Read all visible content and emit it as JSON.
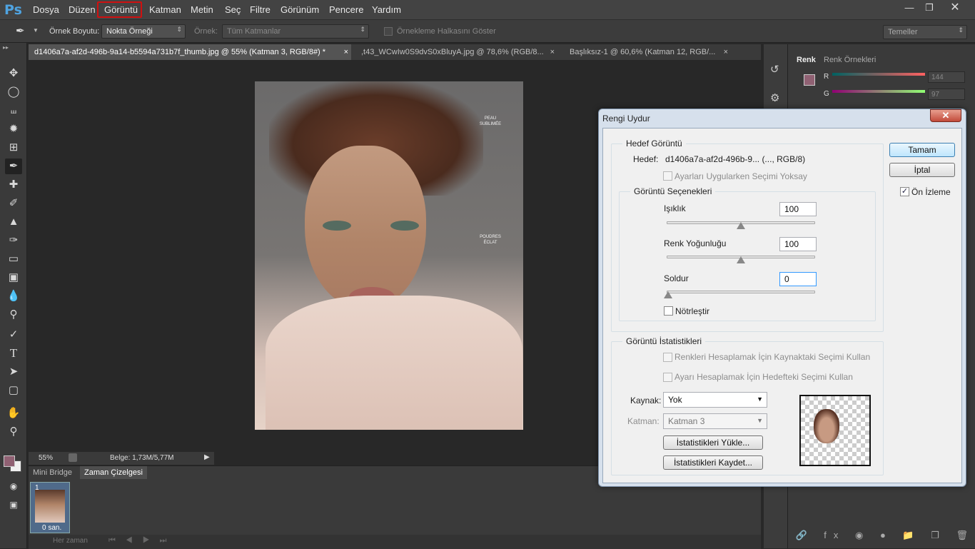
{
  "app": {
    "logo": "Ps"
  },
  "menu": [
    "Dosya",
    "Düzen",
    "Görüntü",
    "Katman",
    "Metin",
    "Seç",
    "Filtre",
    "Görünüm",
    "Pencere",
    "Yardım"
  ],
  "options": {
    "sample_size_label": "Örnek Boyutu:",
    "sample_size_value": "Nokta Örneği",
    "sample_label": "Örnek:",
    "sample_value": "Tüm Katmanlar",
    "show_ring_label": "Örnekleme Halkasını Göster",
    "workspace": "Temeller"
  },
  "tabs": [
    "d1406a7a-af2d-496b-9a14-b5594a731b7f_thumb.jpg @ 55% (Katman 3, RGB/8#) *",
    ",t43_WCwIw0S9dvS0xBluyA.jpg @ 78,6% (RGB/8...",
    "Başlıksız-1 @ 60,6% (Katman 12, RGB/..."
  ],
  "status": {
    "zoom": "55%",
    "doc": "Belge: 1,73M/5,77M"
  },
  "bottom_tabs": [
    "Mini Bridge",
    "Zaman Çizelgesi"
  ],
  "timeline": {
    "frame_num": "1",
    "frame_time": "0 san.",
    "loop": "Her zaman"
  },
  "color_panel": {
    "tab1": "Renk",
    "tab2": "Renk Örnekleri",
    "r_label": "R",
    "g_label": "G",
    "r_value": "144",
    "g_value": "97"
  },
  "dialog": {
    "title": "Rengi Uydur",
    "target_group": "Hedef Görüntü",
    "target_label": "Hedef:",
    "target_value": "d1406a7a-af2d-496b-9... (..., RGB/8)",
    "ignore_selection": "Ayarları Uygularken Seçimi Yoksay",
    "image_options": "Görüntü Seçenekleri",
    "luminance_label": "Işıklık",
    "luminance_value": "100",
    "intensity_label": "Renk Yoğunluğu",
    "intensity_value": "100",
    "fade_label": "Soldur",
    "fade_value": "0",
    "neutralize": "Nötrleştir",
    "stats_group": "Görüntü İstatistikleri",
    "use_source_sel": "Renkleri Hesaplamak İçin Kaynaktaki Seçimi Kullan",
    "use_target_sel": "Ayarı Hesaplamak İçin Hedefteki Seçimi Kullan",
    "source_label": "Kaynak:",
    "source_value": "Yok",
    "layer_label": "Katman:",
    "layer_value": "Katman 3",
    "load_stats": "İstatistikleri Yükle...",
    "save_stats": "İstatistikleri Kaydet...",
    "ok": "Tamam",
    "cancel": "İptal",
    "preview": "Ön İzleme"
  },
  "magazine_text": [
    "PEAU",
    "SUBLIMÉE",
    "POUDRES",
    "ÉCLAT"
  ]
}
